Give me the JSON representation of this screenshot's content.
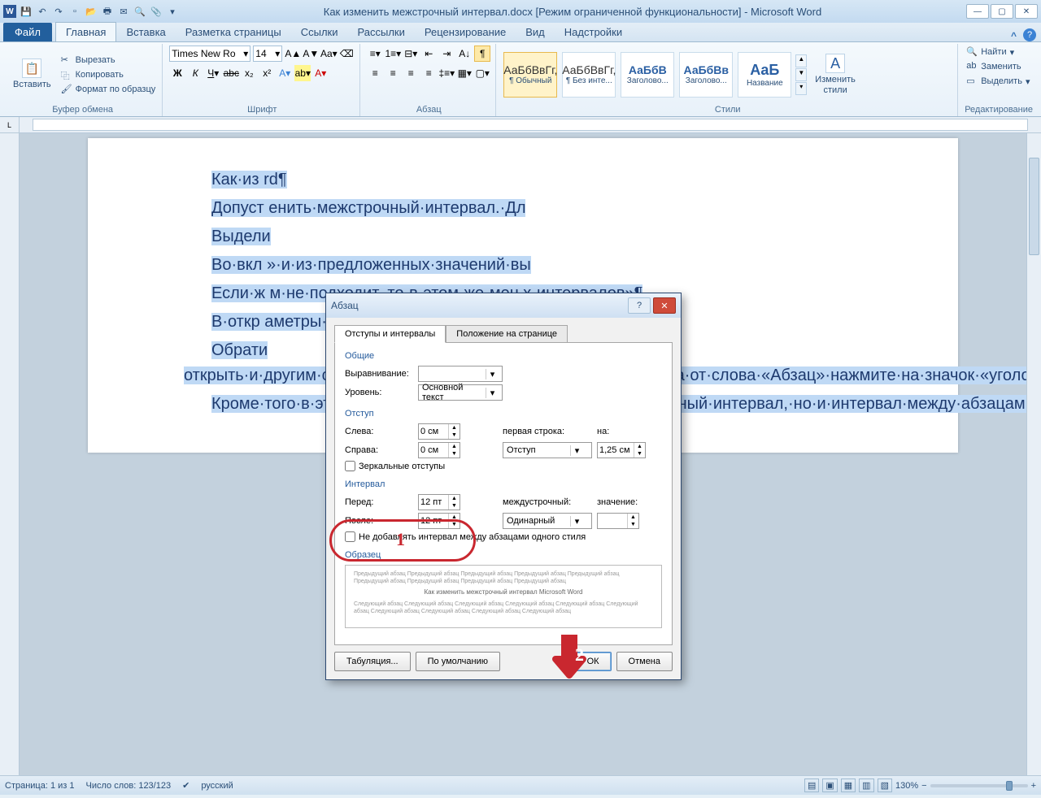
{
  "titlebar": {
    "title": "Как изменить межстрочный интервал.docx [Режим ограниченной функциональности] - Microsoft Word"
  },
  "tabs": {
    "file": "Файл",
    "items": [
      "Главная",
      "Вставка",
      "Разметка страницы",
      "Ссылки",
      "Рассылки",
      "Рецензирование",
      "Вид",
      "Надстройки"
    ]
  },
  "ribbon": {
    "paste": "Вставить",
    "cut": "Вырезать",
    "copy": "Копировать",
    "format_painter": "Формат по образцу",
    "group_clipboard": "Буфер обмена",
    "font_name": "Times New Ro",
    "font_size": "14",
    "group_font": "Шрифт",
    "group_paragraph": "Абзац",
    "group_styles": "Стили",
    "group_editing": "Редактирование",
    "styles": [
      {
        "preview": "АаБбВвГг,",
        "name": "¶ Обычный"
      },
      {
        "preview": "АаБбВвГг,",
        "name": "¶ Без инте..."
      },
      {
        "preview": "АаБбВ",
        "name": "Заголово..."
      },
      {
        "preview": "АаБбВв",
        "name": "Заголово..."
      },
      {
        "preview": "АаБ",
        "name": "Название"
      }
    ],
    "change_styles": "Изменить\nстили",
    "find": "Найти",
    "replace": "Заменить",
    "select": "Выделить"
  },
  "document": {
    "p1": "Как·из                                                                                      rd¶",
    "p2": "Допуст                                                                                     енить·межстрочный·интервал.·Дл",
    "p3": "Выдели",
    "p4": "Во·вкл                                                                                     »·и·из·предложенных·значений·вы",
    "p5": "Если·ж                                                                                     м·не·подходит,·то·в·этом·же·мен                                                                                     х·интервалов»¶",
    "p6": "В·откр                                                                                     аметры·интервала·и·нажмите·кн",
    "p7": "Обрати                                                                                     открыть·и·другим·способом.·Для·этого·в·этой·же·вкладке,·справа·от·слова·«Абзац»·нажмите·на·значок·«уголок·со·стрелкой».·Перед·вами·откроется·вышеуказанное·окно.¶",
    "p8": "Кроме·того·в·этом·окне·можно·изменить·не·только·межстрочный·интервал,·но·и·интервал·между·абзацами.·Для·этого·задайте·необходимые·параметры·в·нужном·поле¶"
  },
  "dialog": {
    "title": "Абзац",
    "tab1": "Отступы и интервалы",
    "tab2": "Положение на странице",
    "section_general": "Общие",
    "alignment_label": "Выравнивание:",
    "level_label": "Уровень:",
    "level_value": "Основной текст",
    "section_indent": "Отступ",
    "left_label": "Слева:",
    "left_value": "0 см",
    "right_label": "Справа:",
    "right_value": "0 см",
    "firstline_label": "первая строка:",
    "firstline_value": "Отступ",
    "by_label": "на:",
    "by_value": "1,25 см",
    "mirror": "Зеркальные отступы",
    "section_spacing": "Интервал",
    "before_label": "Перед:",
    "before_value": "12 пт",
    "after_label": "После:",
    "after_value": "12 пт",
    "linespacing_label": "междустрочный:",
    "linespacing_value": "Одинарный",
    "at_label": "значение:",
    "noadd": "Не добавлять интервал между абзацами одного стиля",
    "section_preview": "Образец",
    "preview_title": "Как изменить межстрочный интервал Microsoft Word",
    "btn_tabs": "Табуляция...",
    "btn_default": "По умолчанию",
    "btn_ok": "ОК",
    "btn_cancel": "Отмена"
  },
  "annotations": {
    "one": "1",
    "two": "2"
  },
  "status": {
    "page": "Страница: 1 из 1",
    "words": "Число слов: 123/123",
    "lang": "русский",
    "zoom": "130%"
  }
}
